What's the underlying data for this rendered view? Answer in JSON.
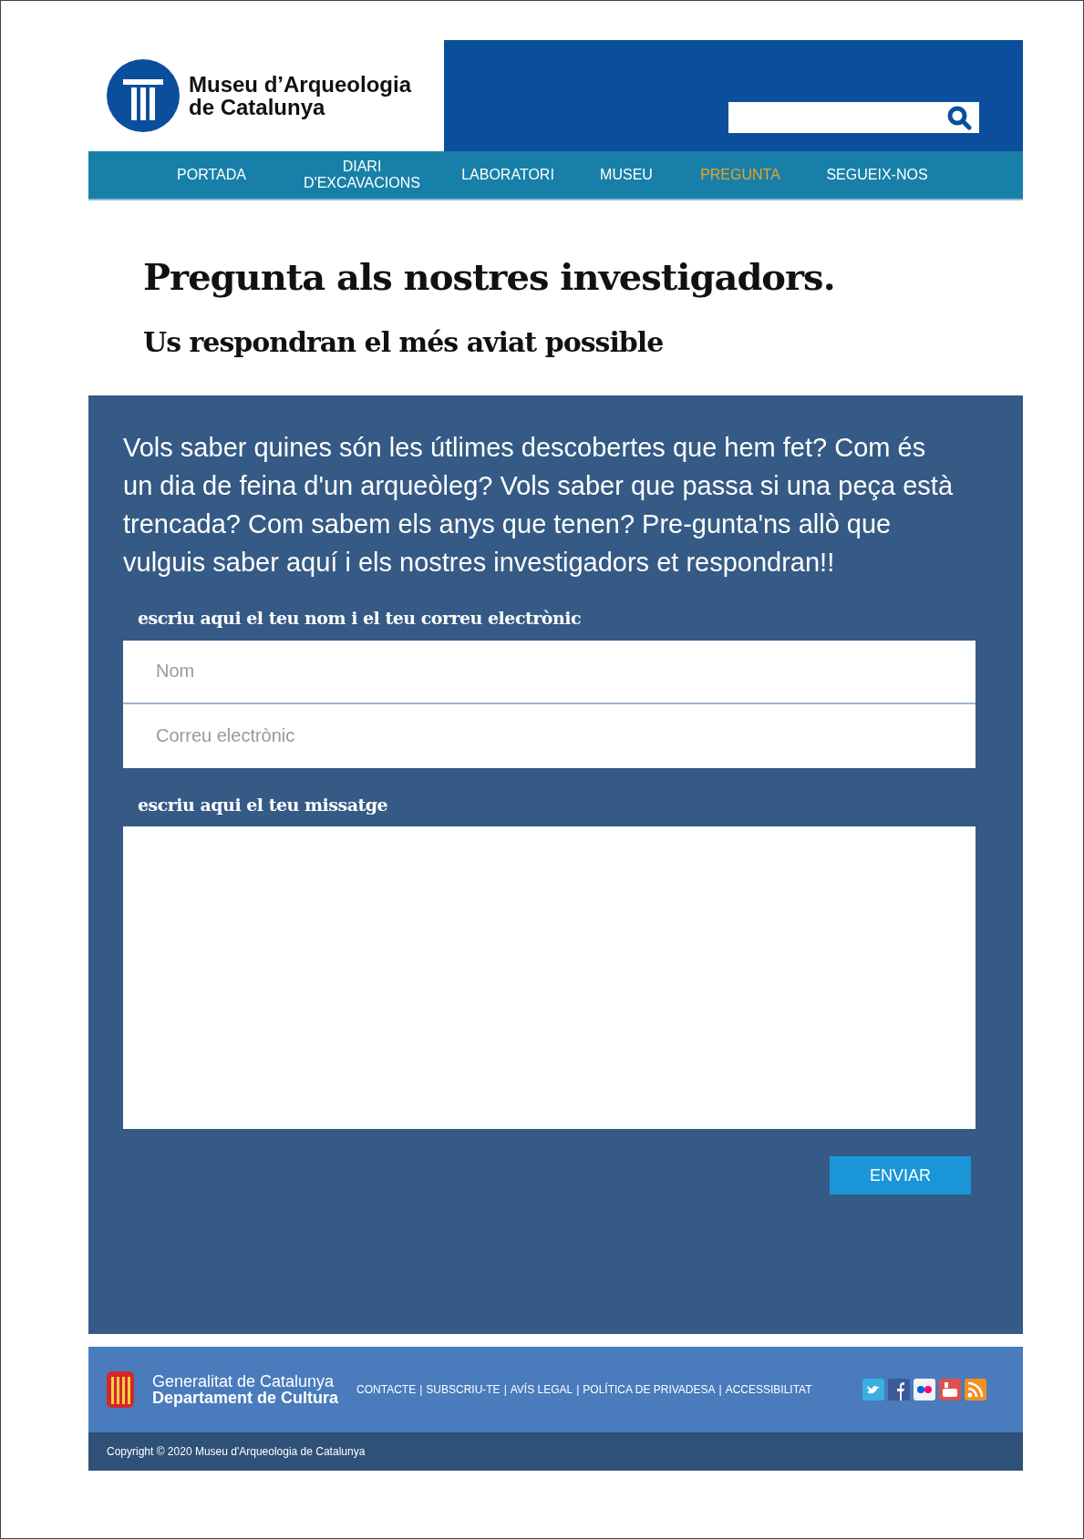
{
  "header": {
    "logo_text": [
      "Museu d’Arqueologia",
      "de Catalunya"
    ]
  },
  "nav": [
    {
      "label": "PORTADA",
      "selected": false
    },
    {
      "label": "DIARI D'EXCAVACIONS",
      "selected": false
    },
    {
      "label": "LABORATORI",
      "selected": false
    },
    {
      "label": "MUSEU",
      "selected": false
    },
    {
      "label": "PREGUNTA",
      "selected": true
    },
    {
      "label": "SEGUEIX-NOS",
      "selected": false
    }
  ],
  "title": "Pregunta als nostres investigadors.",
  "subtitle": "Us respondran el més aviat possible",
  "form": {
    "intro": "Vols saber quines són les útlimes descobertes que hem fet? Com és un dia de feina d'un arqueòleg? Vols saber que passa si una peça està trencada? Com sabem els anys que tenen? Pre-gunta'ns allò que vulguis saber aquí i els nostres investigadors et respondran!!",
    "contact_label": "escriu aqui el teu nom i el teu correu electrònic",
    "name_field": {
      "placeholder": "Nom"
    },
    "email_field": {
      "placeholder": "Correu electrònic"
    },
    "message_label": "escriu aqui el teu missatge",
    "submit": "ENVIAR"
  },
  "footer": {
    "org": [
      "Generalitat de Catalunya",
      "Departament de Cultura"
    ],
    "links": [
      "CONTACTE",
      "SUBSCRIU-TE",
      "AVÍS LEGAL",
      "POLÍTICA DE PRIVADESA",
      "ACCESSIBILITAT"
    ],
    "separator": "|",
    "copyright": "Copyright © 2020 Museu d'Arqueologia de Catalunya"
  }
}
